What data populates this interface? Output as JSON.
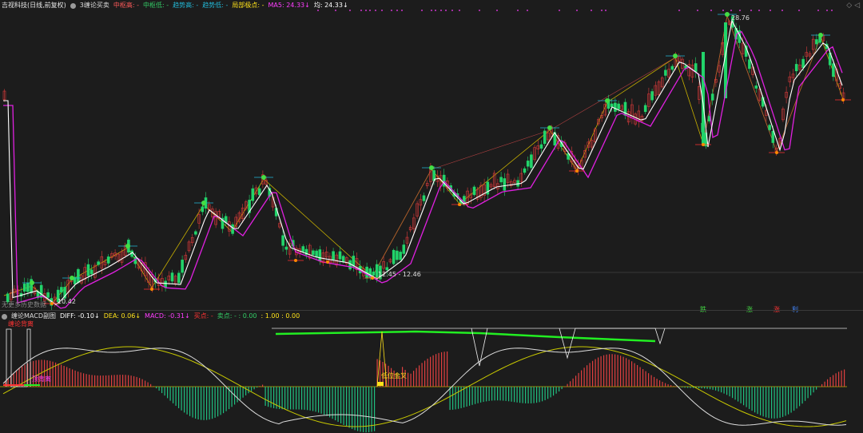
{
  "main_header": {
    "stock_name": "吉视科技(日线,前复权)",
    "indicator_name": "3缠论买卖",
    "items": [
      {
        "text": "中枢高: -",
        "color": "#ff5a5a"
      },
      {
        "text": "中枢低: -",
        "color": "#33cc66"
      },
      {
        "text": "趋势高: -",
        "color": "#22b8d6"
      },
      {
        "text": "趋势低: -",
        "color": "#22b8d6"
      },
      {
        "text": "局部极点: -",
        "color": "#ffe21a"
      },
      {
        "text": "MA5: 24.33↓",
        "color": "#ff3dff"
      },
      {
        "text": "均: 24.33↓",
        "color": "#ffffff"
      }
    ]
  },
  "price_labels": {
    "high": "28.76",
    "low_range": "12.45 - 12.46",
    "low_left": "10.42",
    "no_data": "无更多历史数据"
  },
  "signal_markers": [
    {
      "text": "跌",
      "color": "#44dd44"
    },
    {
      "text": "涨",
      "color": "#44dd44"
    },
    {
      "text": "涨",
      "color": "#ff3333"
    },
    {
      "text": "利",
      "color": "#4488ff"
    }
  ],
  "macd_header": {
    "indicator_name": "缠论MACD副图",
    "items": [
      {
        "text": "DIFF: -0.10↓",
        "color": "#ffffff"
      },
      {
        "text": "DEA: 0.06↓",
        "color": "#ffe21a"
      },
      {
        "text": "MACD: -0.31↓",
        "color": "#ff3dff"
      },
      {
        "text": "买点: -",
        "color": "#ff3333"
      },
      {
        "text": "卖点: - : 0.00",
        "color": "#33cc66"
      },
      {
        "text": "  : 1.00 : 0.00",
        "color": "#ffe21a"
      }
    ],
    "sub_label": "缠论背离"
  },
  "macd_labels": {
    "low_golden_cross": "低位金叉",
    "left_label": "顶背离"
  },
  "colors": {
    "up_candle": "#d83a3a",
    "down_candle": "#22d46a",
    "ma_white": "#ffffff",
    "ma_magenta": "#e020e0",
    "zigzag": "#c8b000",
    "hist_up": "#e04040",
    "hist_down": "#20c080"
  },
  "chart_data": {
    "type": "candlestick",
    "price_markers": {
      "high": 28.76,
      "low": 12.45,
      "low_left": 10.42
    },
    "macd": {
      "diff": -0.1,
      "dea": 0.06,
      "macd": -0.31
    }
  }
}
